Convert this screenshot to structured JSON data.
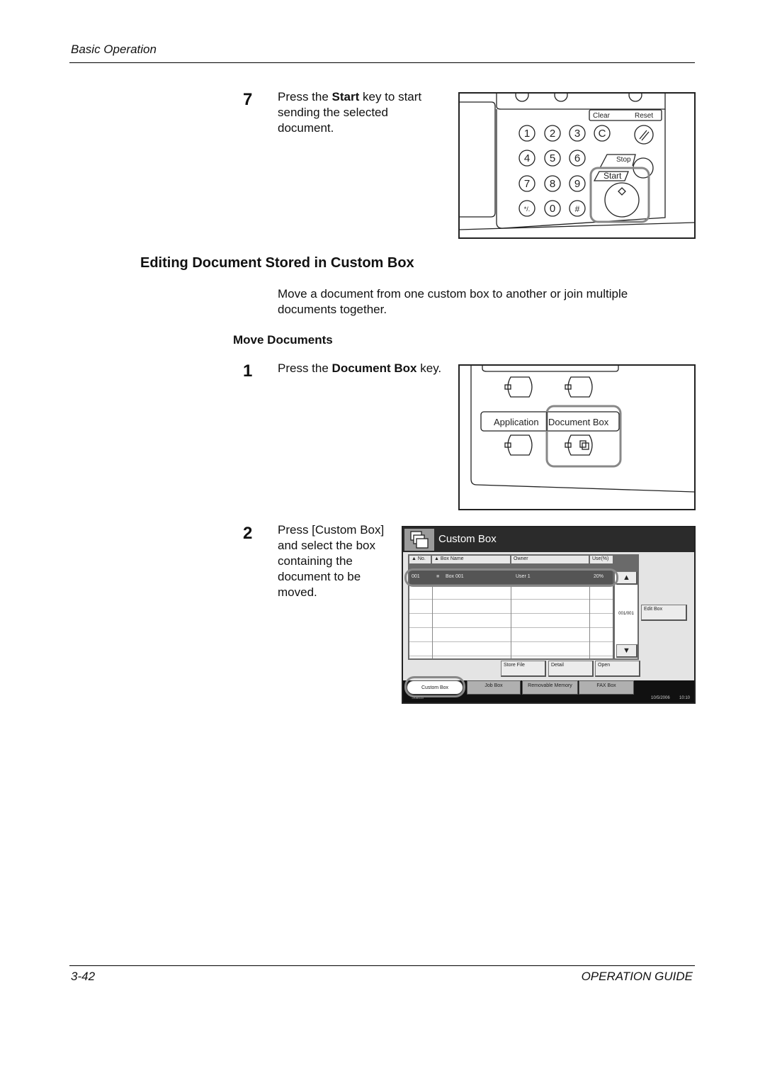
{
  "header": {
    "section": "Basic Operation"
  },
  "step7": {
    "number": "7",
    "text_pre": "Press the ",
    "text_bold": "Start",
    "text_post": " key to start",
    "line2": "sending the selected",
    "line3": "document."
  },
  "keypad": {
    "clear": "Clear",
    "reset": "Reset",
    "stop": "Stop",
    "start": "Start",
    "keys": [
      "1",
      "2",
      "3",
      "C",
      "4",
      "5",
      "6",
      "7",
      "8",
      "9",
      "*/.",
      "0",
      "#"
    ]
  },
  "heading": "Editing Document Stored in Custom Box",
  "intro": {
    "line1": "Move a document from one custom box to another or join multiple",
    "line2": "documents together."
  },
  "subheading": "Move Documents",
  "step1": {
    "number": "1",
    "text_pre": "Press the ",
    "text_bold": "Document Box",
    "text_post": " key."
  },
  "panel": {
    "application": "Application",
    "document_box": "Document Box"
  },
  "step2": {
    "number": "2",
    "lines": [
      "Press [Custom Box]",
      "and select the box",
      "containing the",
      "document to be",
      "moved."
    ]
  },
  "screen": {
    "title": "Custom Box",
    "columns": [
      "No.",
      "Box Name",
      "Owner",
      "Use(%)"
    ],
    "rows": [
      {
        "no": "001",
        "name": "Box 001",
        "owner": "User 1",
        "use": "20%"
      }
    ],
    "page": "001/001",
    "buttons": {
      "edit_box": "Edit Box",
      "store_file": "Store File",
      "detail": "Detail",
      "open": "Open"
    },
    "tabs": [
      "Custom Box",
      "Job Box",
      "Removable Memory",
      "FAX Box"
    ],
    "status": "Status",
    "date": "10/5/2006",
    "time": "10:10"
  },
  "footer": {
    "page": "3-42",
    "guide": "OPERATION GUIDE"
  }
}
